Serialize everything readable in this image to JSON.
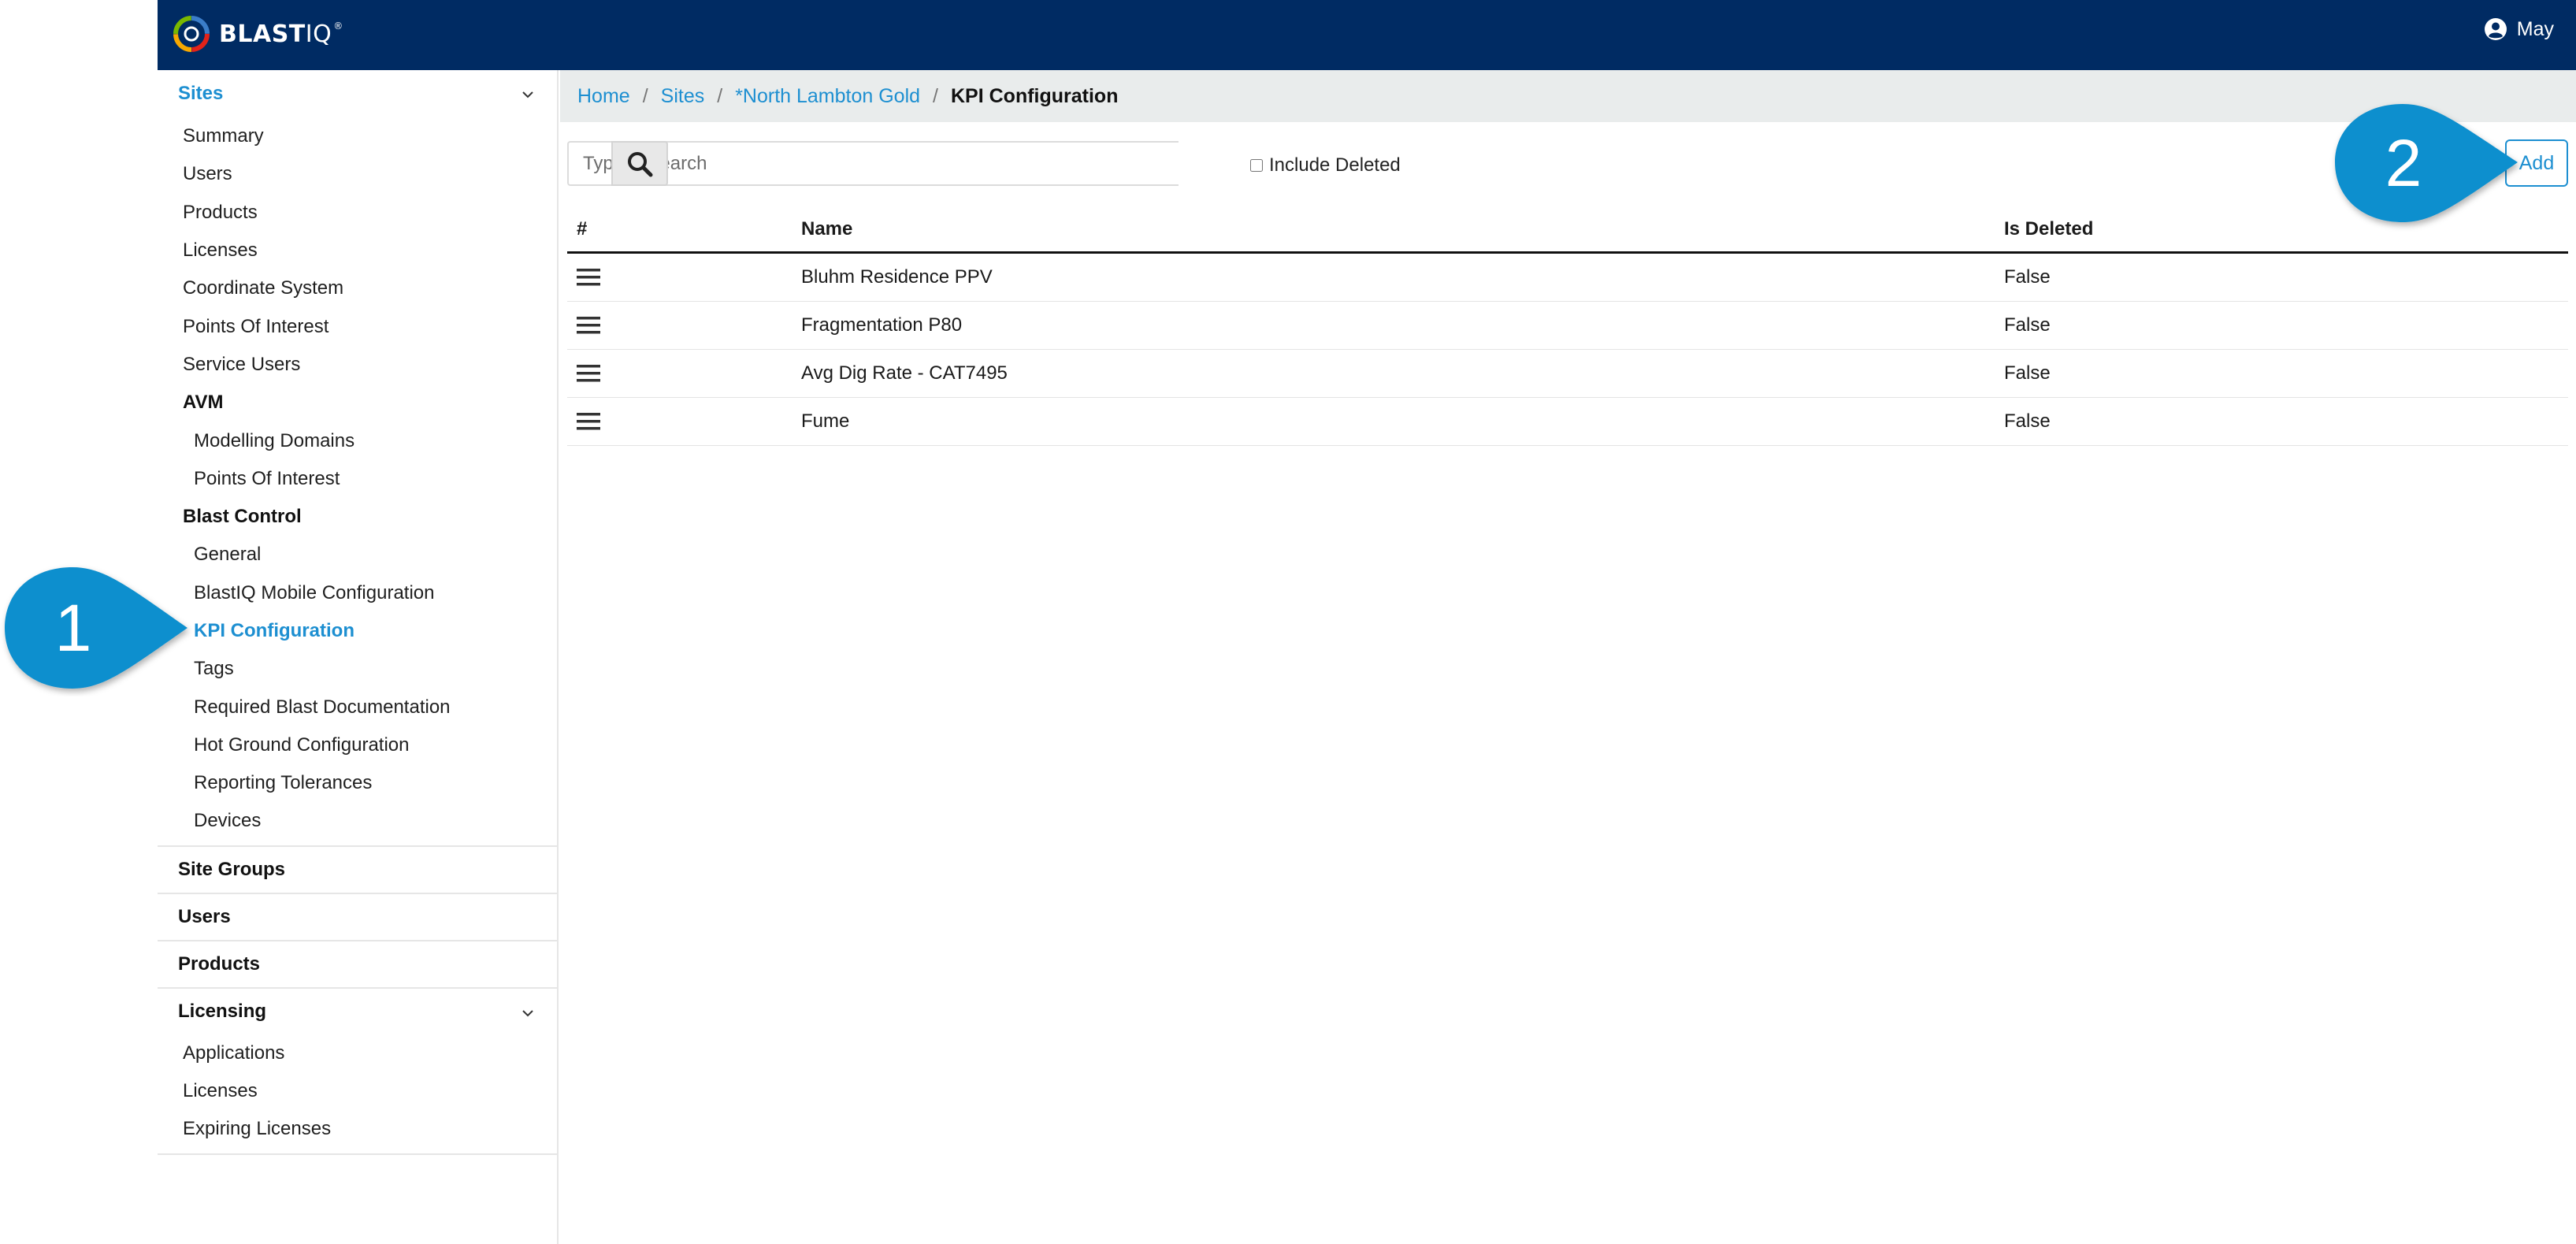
{
  "app": {
    "logo_text": "BLAST",
    "logo_iq": "IQ",
    "logo_tm": "®",
    "user_name": "May"
  },
  "sidebar": {
    "sections": [
      {
        "title": "Sites",
        "active": true,
        "expanded": true,
        "items": [
          {
            "label": "Summary",
            "level": 1
          },
          {
            "label": "Users",
            "level": 1
          },
          {
            "label": "Products",
            "level": 1
          },
          {
            "label": "Licenses",
            "level": 1
          },
          {
            "label": "Coordinate System",
            "level": 1
          },
          {
            "label": "Points Of Interest",
            "level": 1
          },
          {
            "label": "Service Users",
            "level": 1
          },
          {
            "label": "AVM",
            "level": 1,
            "group": true
          },
          {
            "label": "Modelling Domains",
            "level": 2
          },
          {
            "label": "Points Of Interest",
            "level": 2
          },
          {
            "label": "Blast Control",
            "level": 1,
            "group": true
          },
          {
            "label": "General",
            "level": 2
          },
          {
            "label": "BlastIQ Mobile Configuration",
            "level": 2
          },
          {
            "label": "KPI Configuration",
            "level": 2,
            "active": true
          },
          {
            "label": "Tags",
            "level": 2
          },
          {
            "label": "Required Blast Documentation",
            "level": 2
          },
          {
            "label": "Hot Ground Configuration",
            "level": 2
          },
          {
            "label": "Reporting Tolerances",
            "level": 2
          },
          {
            "label": "Devices",
            "level": 2
          }
        ]
      },
      {
        "title": "Site Groups",
        "items": []
      },
      {
        "title": "Users",
        "items": []
      },
      {
        "title": "Products",
        "items": []
      },
      {
        "title": "Licensing",
        "expanded": true,
        "items": [
          {
            "label": "Applications",
            "level": 1
          },
          {
            "label": "Licenses",
            "level": 1
          },
          {
            "label": "Expiring Licenses",
            "level": 1
          }
        ]
      }
    ]
  },
  "breadcrumb": {
    "items": [
      "Home",
      "Sites",
      "*North Lambton Gold"
    ],
    "current": "KPI Configuration"
  },
  "search": {
    "placeholder": "Type to search",
    "value": "",
    "include_deleted_label": "Include Deleted",
    "include_deleted_checked": false
  },
  "toolbar": {
    "add_label": "Add"
  },
  "table": {
    "headers": [
      "#",
      "Name",
      "Is Deleted"
    ],
    "rows": [
      {
        "name": "Bluhm Residence PPV",
        "is_deleted": "False"
      },
      {
        "name": "Fragmentation P80",
        "is_deleted": "False"
      },
      {
        "name": "Avg Dig Rate - CAT7495",
        "is_deleted": "False"
      },
      {
        "name": "Fume",
        "is_deleted": "False"
      }
    ]
  },
  "callouts": [
    {
      "number": "1"
    },
    {
      "number": "2"
    }
  ],
  "colors": {
    "navbar": "#002b63",
    "accent": "#1d8fd1",
    "callout": "#0f8fce"
  }
}
